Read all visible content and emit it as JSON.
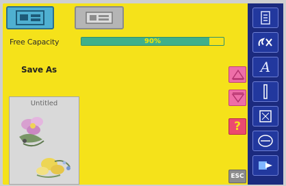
{
  "tabs": {
    "folder_icon": "folder-tree-icon",
    "machine_icon": "sewing-machine-icon"
  },
  "capacity": {
    "label": "Free Capacity",
    "percent_text": "90%",
    "fraction": 0.9,
    "fill_color": "#3fb08a"
  },
  "save": {
    "title": "Save As"
  },
  "preview": {
    "title": "Untitled"
  },
  "buttons": {
    "help_label": "?",
    "esc_label": "ESC"
  },
  "toolbar": {
    "items": [
      "info-icon",
      "stitch-icon",
      "text-icon",
      "needle-icon",
      "frame-icon",
      "hoop-icon",
      "exit-icon"
    ],
    "text_label": "A"
  },
  "colors": {
    "background": "#f5e21a",
    "accent_pink": "#ee6ea8",
    "toolbar_blue": "#1b2a7e"
  }
}
